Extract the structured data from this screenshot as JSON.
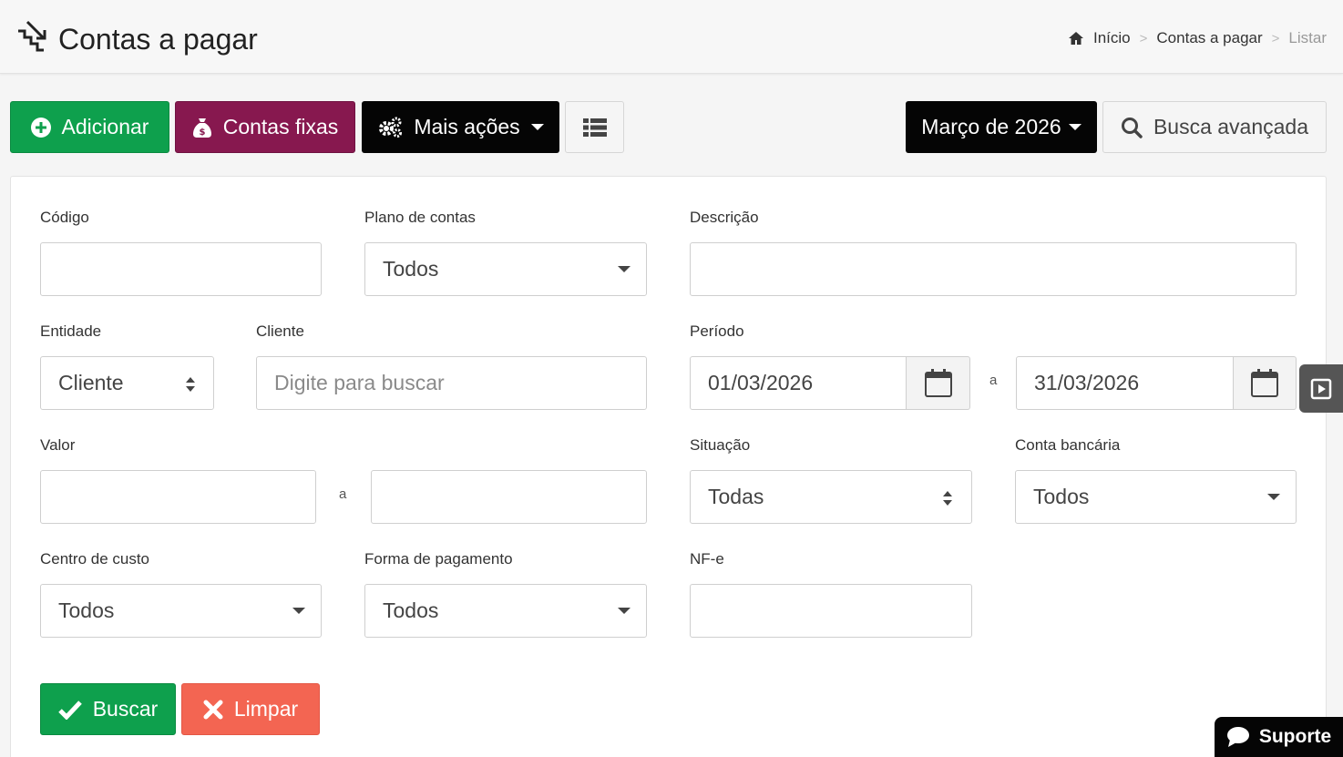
{
  "header": {
    "title": "Contas a pagar",
    "title_icon": "stairs-down-icon",
    "breadcrumb": {
      "home_icon": "home-icon",
      "home": "Início",
      "separator": ">",
      "section": "Contas a pagar",
      "current": "Listar"
    }
  },
  "toolbar": {
    "add_label": "Adicionar",
    "fixed_label": "Contas fixas",
    "more_label": "Mais ações",
    "month_label": "Março de 2026",
    "advanced_search_label": "Busca avançada"
  },
  "filters": {
    "codigo": {
      "label": "Código",
      "value": ""
    },
    "plano_contas": {
      "label": "Plano de contas",
      "value": "Todos"
    },
    "descricao": {
      "label": "Descrição",
      "value": ""
    },
    "entidade": {
      "label": "Entidade",
      "value": "Cliente"
    },
    "cliente": {
      "label": "Cliente",
      "placeholder": "Digite para buscar"
    },
    "periodo": {
      "label": "Período",
      "from": "01/03/2026",
      "separator": "a",
      "to": "31/03/2026"
    },
    "valor": {
      "label": "Valor",
      "from": "",
      "separator": "a",
      "to": ""
    },
    "situacao": {
      "label": "Situação",
      "value": "Todas"
    },
    "conta_bancaria": {
      "label": "Conta bancária",
      "value": "Todos"
    },
    "centro_custo": {
      "label": "Centro de custo",
      "value": "Todos"
    },
    "forma_pagamento": {
      "label": "Forma de pagamento",
      "value": "Todos"
    },
    "nfe": {
      "label": "NF-e",
      "value": ""
    }
  },
  "actions": {
    "search_label": "Buscar",
    "clear_label": "Limpar"
  },
  "support": {
    "label": "Suporte"
  },
  "colors": {
    "success": "#0ea04d",
    "purple": "#87184f",
    "dark": "#050505",
    "danger": "#f36552"
  }
}
